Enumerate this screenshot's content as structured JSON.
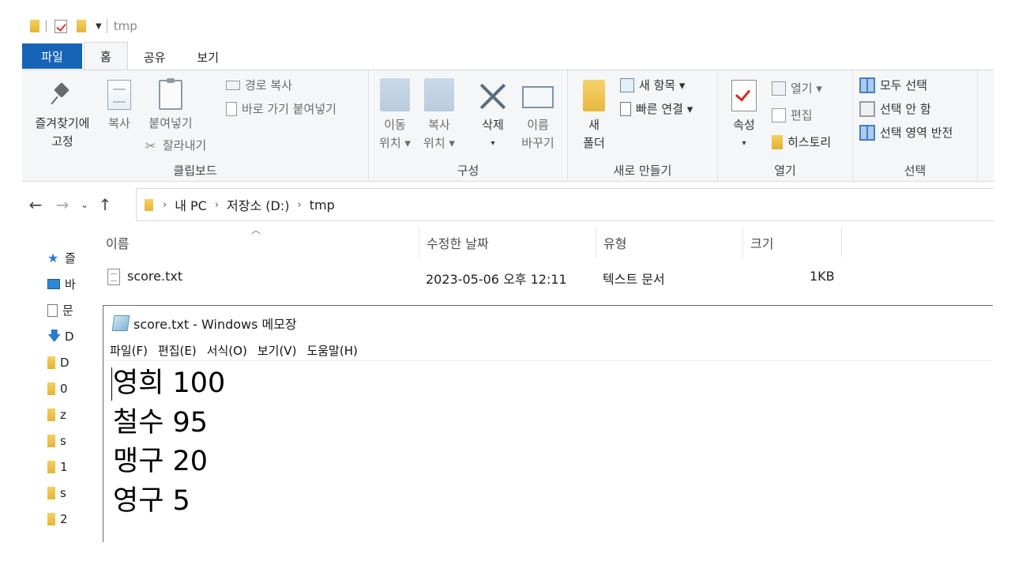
{
  "quick_access": {
    "title": "tmp"
  },
  "tabs": [
    {
      "label": "파일"
    },
    {
      "label": "홈"
    },
    {
      "label": "공유"
    },
    {
      "label": "보기"
    }
  ],
  "ribbon": {
    "clipboard": {
      "label": "클립보드",
      "pin_line1": "즐겨찾기에",
      "pin_line2": "고정",
      "copy": "복사",
      "paste": "붙여넣기",
      "copy_path": "경로 복사",
      "paste_shortcut": "바로 가기 붙여넣기",
      "cut": "잘라내기"
    },
    "organize": {
      "label": "구성",
      "move_line1": "이동",
      "move_line2": "위치 ▾",
      "copyto_line1": "복사",
      "copyto_line2": "위치 ▾",
      "delete": "삭제",
      "delete_arrow": "▾",
      "rename_line1": "이름",
      "rename_line2": "바꾸기"
    },
    "new": {
      "label": "새로 만들기",
      "folder_line1": "새",
      "folder_line2": "폴더",
      "new_item": "새 항목 ▾",
      "easy_access": "빠른 연결 ▾"
    },
    "open": {
      "label": "열기",
      "properties": "속성",
      "properties_arrow": "▾",
      "open": "열기 ▾",
      "edit": "편집",
      "history": "히스토리"
    },
    "select": {
      "label": "선택",
      "select_all": "모두 선택",
      "select_none": "선택 안 함",
      "invert": "선택 영역 반전"
    }
  },
  "address": {
    "crumbs": [
      "내 PC",
      "저장소 (D:)",
      "tmp"
    ]
  },
  "navpane": {
    "items": [
      "즐",
      "바",
      "문",
      "D",
      "D",
      "0",
      "z",
      "s",
      "1",
      "s",
      "2"
    ]
  },
  "columns": {
    "name": "이름",
    "modified": "수정한 날짜",
    "type": "유형",
    "size": "크기"
  },
  "files": [
    {
      "name": "score.txt",
      "modified": "2023-05-06 오후 12:11",
      "type": "텍스트 문서",
      "size": "1KB"
    }
  ],
  "notepad": {
    "title": "score.txt - Windows 메모장",
    "menu": [
      "파일(F)",
      "편집(E)",
      "서식(O)",
      "보기(V)",
      "도움말(H)"
    ],
    "lines": [
      "영희 100",
      "철수 95",
      "맹구 20",
      "영구 5"
    ]
  }
}
